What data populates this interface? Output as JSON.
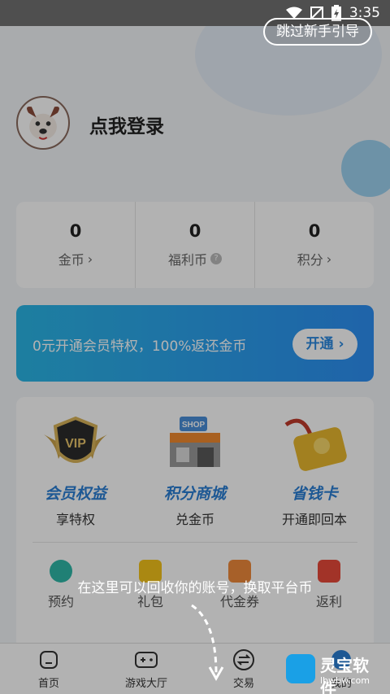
{
  "status_bar": {
    "time": "3:35",
    "icons": [
      "wifi-icon",
      "signal-off-icon",
      "battery-charging-icon"
    ]
  },
  "top": {
    "skip_guide": "跳过新手引导",
    "login": "点我登录"
  },
  "stats": [
    {
      "value": "0",
      "label": "金币",
      "suffix": "›",
      "icon": "chevron-right-icon"
    },
    {
      "value": "0",
      "label": "福利币",
      "suffix": "?",
      "icon": "question-icon"
    },
    {
      "value": "0",
      "label": "积分",
      "suffix": "›",
      "icon": "chevron-right-icon"
    }
  ],
  "banner": {
    "text": "0元开通会员特权，100%返还金币",
    "button": "开通 ›"
  },
  "features": [
    {
      "title": "会员权益",
      "sub": "享特权",
      "icon": "vip-badge-icon"
    },
    {
      "title": "积分商城",
      "sub": "兑金币",
      "icon": "shop-icon"
    },
    {
      "title": "省钱卡",
      "sub": "开通即回本",
      "icon": "savings-card-icon"
    }
  ],
  "shortcuts": [
    {
      "label": "预约",
      "icon": "clock-icon",
      "color": "#2fb8a8"
    },
    {
      "label": "礼包",
      "icon": "gift-icon",
      "color": "#f4c31b"
    },
    {
      "label": "代金券",
      "icon": "voucher-icon",
      "color": "#f08a3c"
    },
    {
      "label": "返利",
      "icon": "red-envelope-icon",
      "color": "#e84a3a"
    }
  ],
  "tabs": [
    {
      "label": "首页",
      "icon": "home-icon"
    },
    {
      "label": "游戏大厅",
      "icon": "gamepad-icon"
    },
    {
      "label": "交易",
      "icon": "exchange-icon"
    },
    {
      "label": "我的",
      "icon": "profile-icon"
    }
  ],
  "guide": {
    "hint": "在这里可以回收你的账号，换取平台币"
  },
  "watermark": {
    "name": "灵宝软件",
    "site": "lbwbw.com"
  },
  "colors": {
    "accent": "#2a7fd4",
    "banner_start": "#2ab6e6",
    "banner_end": "#2d8ff3"
  }
}
